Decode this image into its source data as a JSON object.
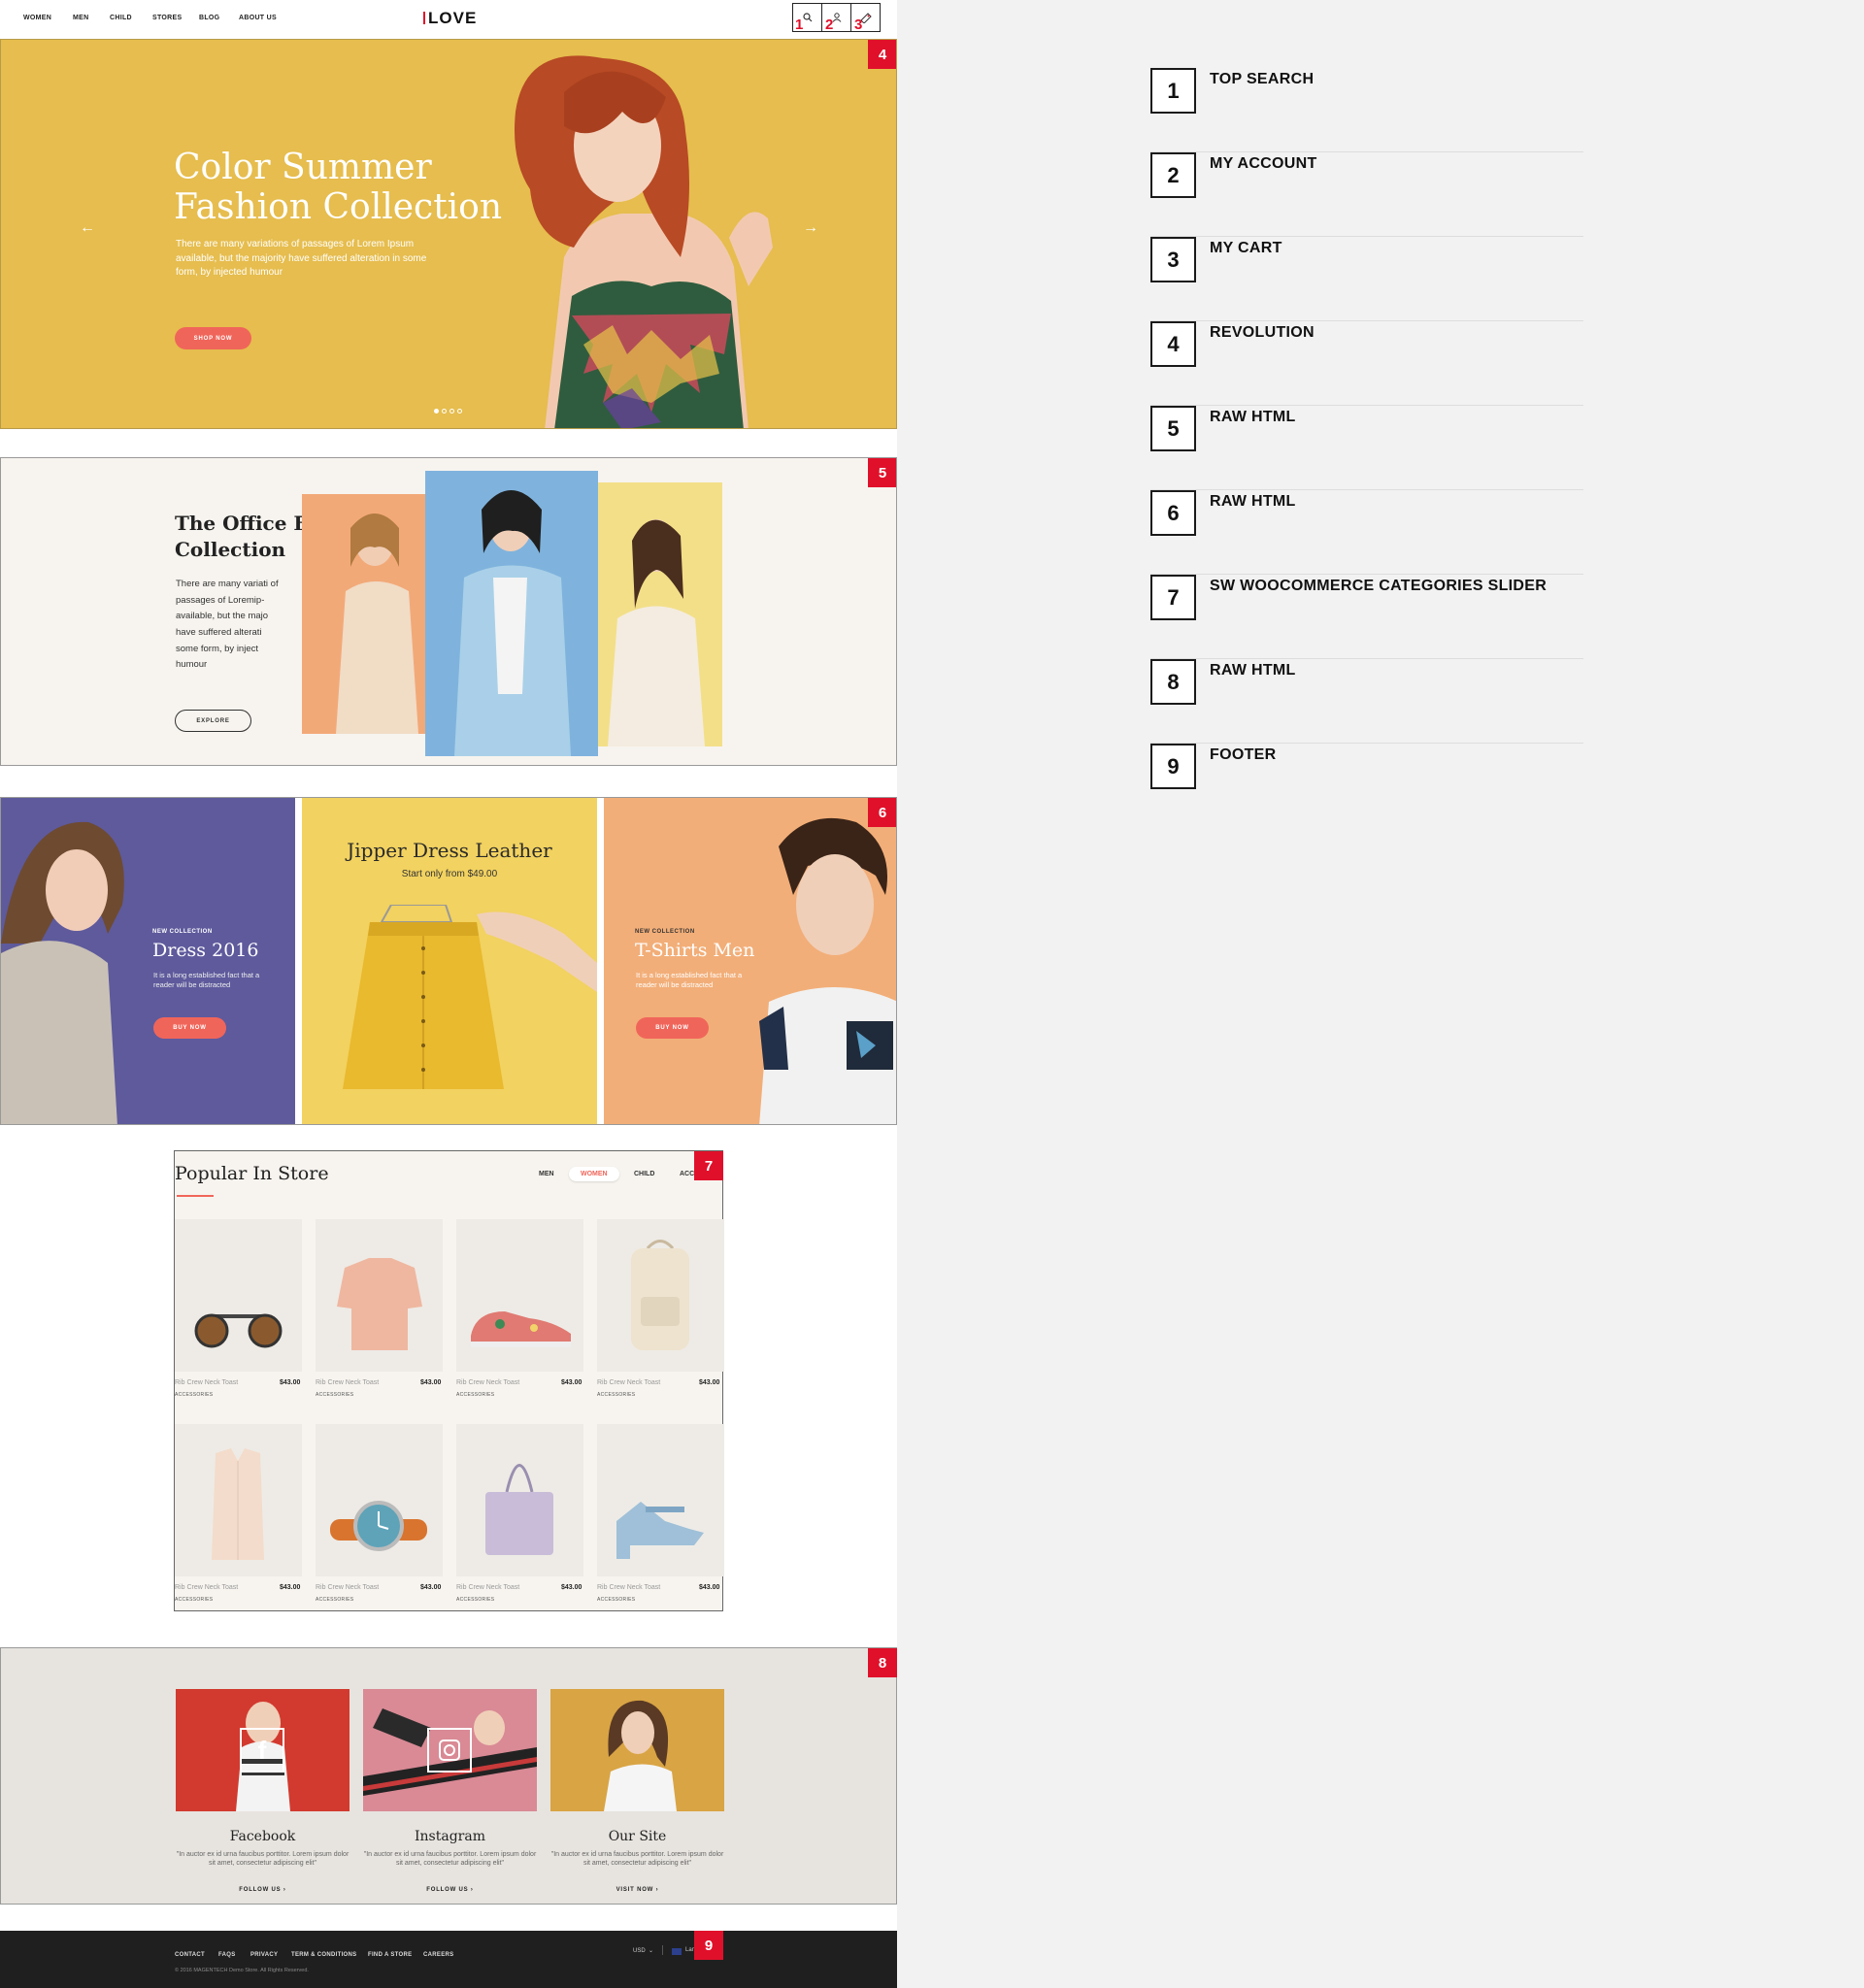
{
  "header": {
    "nav": [
      "WOMEN",
      "MEN",
      "CHILD",
      "STORES",
      "BLOG",
      "ABOUT US"
    ],
    "logo": "LOVE",
    "icon_tags": [
      "1",
      "2",
      "3"
    ]
  },
  "hero": {
    "title_line1": "Color Summer",
    "title_line2": "Fashion Collection",
    "text": "There are many variations of passages of Lorem Ipsum available, but the majority have suffered alteration in some form, by injected humour",
    "button": "SHOP NOW",
    "badge": "4",
    "prev_arrow": "←",
    "next_arrow": "→"
  },
  "office": {
    "title_line1": "The Office FS",
    "title_line2": "Collection",
    "text": "There are many variati of passages of Loremip- available, but the majo have suffered alterati some form, by inject humour",
    "button": "EXPLORE",
    "badge": "5"
  },
  "banners": {
    "badge": "6",
    "left": {
      "kicker": "NEW COLLECTION",
      "title": "Dress 2016",
      "text": "It is a long established fact that a reader will be distracted",
      "button": "BUY NOW"
    },
    "center": {
      "title": "Jipper Dress Leather",
      "subtitle": "Start only from $49.00"
    },
    "right": {
      "kicker": "NEW COLLECTION",
      "title": "T-Shirts Men",
      "text": "It is a long established fact that a reader will be distracted",
      "button": "BUY NOW"
    }
  },
  "popular": {
    "title": "Popular In Store",
    "badge": "7",
    "tabs": [
      "MEN",
      "WOMEN",
      "CHILD",
      "ACC"
    ],
    "active_tab": "WOMEN",
    "products": [
      {
        "name": "Rib Crew Neck Toast",
        "price": "$43.00",
        "category": "ACCESSORIES",
        "icon": "sunglasses"
      },
      {
        "name": "Rib Crew Neck Toast",
        "price": "$43.00",
        "category": "ACCESSORIES",
        "icon": "tshirt"
      },
      {
        "name": "Rib Crew Neck Toast",
        "price": "$43.00",
        "category": "ACCESSORIES",
        "icon": "sneaker"
      },
      {
        "name": "Rib Crew Neck Toast",
        "price": "$43.00",
        "category": "ACCESSORIES",
        "icon": "backpack"
      },
      {
        "name": "Rib Crew Neck Toast",
        "price": "$43.00",
        "category": "ACCESSORIES",
        "icon": "vest"
      },
      {
        "name": "Rib Crew Neck Toast",
        "price": "$43.00",
        "category": "ACCESSORIES",
        "icon": "watch"
      },
      {
        "name": "Rib Crew Neck Toast",
        "price": "$43.00",
        "category": "ACCESSORIES",
        "icon": "tote-bag"
      },
      {
        "name": "Rib Crew Neck Toast",
        "price": "$43.00",
        "category": "ACCESSORIES",
        "icon": "sandal"
      }
    ]
  },
  "social": {
    "badge": "8",
    "cards": [
      {
        "title": "Facebook",
        "text": "\"In auctor ex id urna faucibus porttitor. Lorem ipsum dolor sit amet, consectetur adipiscing elit\"",
        "link": "FOLLOW US ›"
      },
      {
        "title": "Instagram",
        "text": "\"In auctor ex id urna faucibus porttitor. Lorem ipsum dolor sit amet, consectetur adipiscing elit\"",
        "link": "FOLLOW US ›"
      },
      {
        "title": "Our Site",
        "text": "\"In auctor ex id urna faucibus porttitor. Lorem ipsum dolor sit amet, consectetur adipiscing elit\"",
        "link": "VISIT NOW ›"
      }
    ]
  },
  "footer": {
    "links": [
      "CONTACT",
      "FAQS",
      "PRIVACY",
      "TERM & CONDITIONS",
      "FIND A STORE",
      "CAREERS"
    ],
    "copyright": "© 2016 MAGENTECH Demo Store. All Rights Reserved.",
    "currency": "USD",
    "language": "Lan",
    "badge": "9"
  },
  "legend": [
    {
      "num": "1",
      "label": "TOP SEARCH"
    },
    {
      "num": "2",
      "label": "MY ACCOUNT"
    },
    {
      "num": "3",
      "label": "MY CART"
    },
    {
      "num": "4",
      "label": "REVOLUTION"
    },
    {
      "num": "5",
      "label": "RAW HTML"
    },
    {
      "num": "6",
      "label": "RAW HTML"
    },
    {
      "num": "7",
      "label": "SW WOOCOMMERCE CATEGORIES SLIDER"
    },
    {
      "num": "8",
      "label": "RAW HTML"
    },
    {
      "num": "9",
      "label": "FOOTER"
    }
  ],
  "colors": {
    "accent_red": "#e0102a",
    "button_coral": "#f0655a",
    "hero_yellow": "#e6bd4e",
    "banner_purple": "#5e5a9c",
    "banner_yellow": "#f2d260",
    "banner_orange": "#f2ae78"
  }
}
